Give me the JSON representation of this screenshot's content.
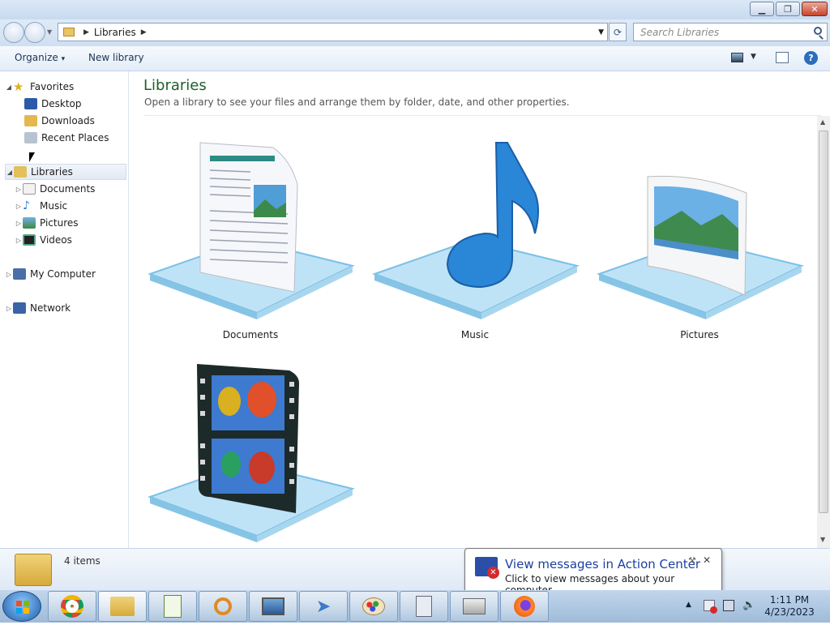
{
  "window": {
    "minimize_icon": "minimize-icon",
    "restore_icon": "restore-icon",
    "close_icon": "close-icon"
  },
  "address": {
    "path": "Libraries",
    "search_placeholder": "Search Libraries"
  },
  "toolbar": {
    "organize": "Organize",
    "organize_arrow": "▾",
    "new_library": "New library"
  },
  "sidebar": {
    "favorites": "Favorites",
    "favorites_items": [
      "Desktop",
      "Downloads",
      "Recent Places"
    ],
    "libraries": "Libraries",
    "libraries_items": [
      "Documents",
      "Music",
      "Pictures",
      "Videos"
    ],
    "computer": "My Computer",
    "network": "Network"
  },
  "main": {
    "title": "Libraries",
    "subtitle": "Open a library to see your files and arrange them by folder, date, and other properties.",
    "libraries": [
      "Documents",
      "Music",
      "Pictures",
      "Videos"
    ]
  },
  "status": {
    "item_count": "4 items"
  },
  "notification": {
    "title": "View messages in Action Center",
    "subtitle": "Click to view messages about your computer."
  },
  "taskbar": {
    "time": "1:11 PM",
    "date": "4/23/2023",
    "apps": [
      "chrome-icon",
      "explorer-icon",
      "notepad-icon",
      "search-icon",
      "monitor-icon",
      "paper-plane-icon",
      "paint-icon",
      "calculator-icon",
      "printer-icon",
      "firefox-icon"
    ]
  },
  "colors": {
    "accent_title": "#1e5f2a",
    "balloon_title": "#1c3fa0",
    "taskbar": "#a9c3df"
  }
}
